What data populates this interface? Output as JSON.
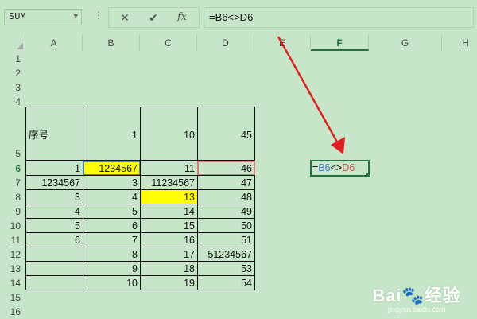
{
  "formula_bar": {
    "name_box": "SUM",
    "cancel_icon": "✕",
    "enter_icon": "✔",
    "fx_label": "fx",
    "formula": "=B6<>D6"
  },
  "columns": [
    "A",
    "B",
    "C",
    "D",
    "E",
    "F",
    "G",
    "H"
  ],
  "active_column": "F",
  "rows": [
    "1",
    "2",
    "3",
    "4",
    "5",
    "6",
    "7",
    "8",
    "9",
    "10",
    "11",
    "12",
    "13",
    "14",
    "15",
    "16"
  ],
  "active_row": "6",
  "cells": {
    "A5": "序号",
    "B5": "1",
    "C5": "10",
    "D5": "45",
    "A6": "1",
    "B6": "1234567",
    "C6": "11",
    "D6": "46",
    "A7": "1234567",
    "B7": "3",
    "C7": "11234567",
    "D7": "47",
    "A8": "3",
    "B8": "4",
    "C8": "13",
    "D8": "48",
    "A9": "4",
    "B9": "5",
    "C9": "14",
    "D9": "49",
    "A10": "5",
    "B10": "6",
    "C10": "15",
    "D10": "50",
    "A11": "6",
    "B11": "7",
    "C11": "16",
    "D11": "51",
    "B12": "8",
    "C12": "17",
    "D12": "51234567",
    "B13": "9",
    "C13": "18",
    "D13": "53",
    "B14": "10",
    "C14": "19",
    "D14": "54"
  },
  "edit_cell": {
    "eq": "=",
    "ref1": "B6",
    "op": "<>",
    "ref2": "D6"
  },
  "watermark": {
    "main": "Bai🐾经验",
    "sub": "jingyan.baidu.com"
  },
  "colors": {
    "sheet_bg": "#c7e6c9",
    "accent": "#217346",
    "yellow": "#ffff00",
    "arrow": "#e02020"
  }
}
